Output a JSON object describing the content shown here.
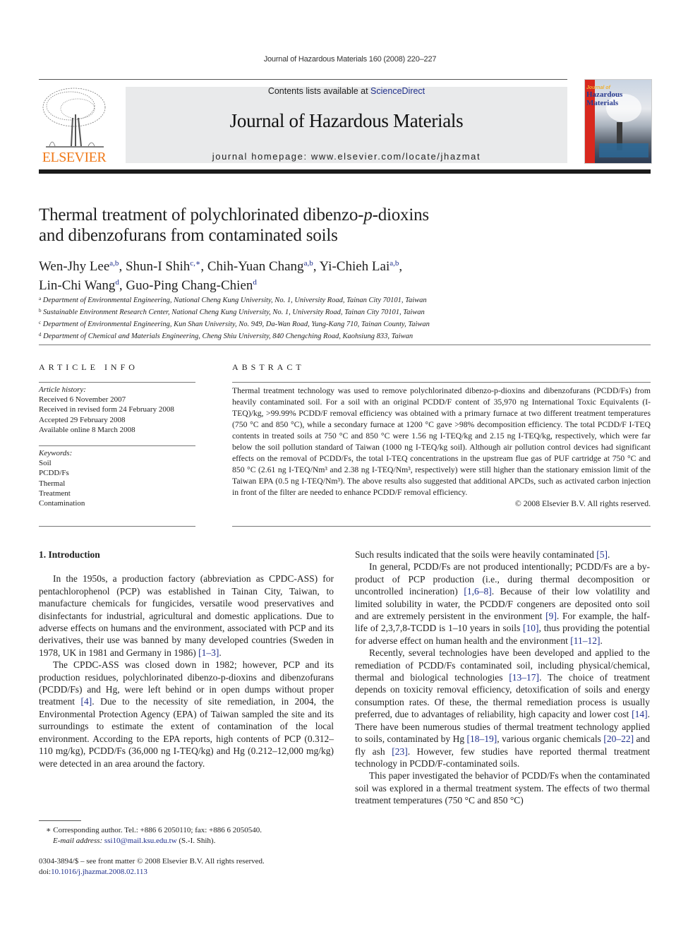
{
  "header": {
    "running_head": "Journal of Hazardous Materials 160 (2008) 220–227",
    "contents_prefix": "Contents lists available at ",
    "contents_link": "ScienceDirect",
    "journal_title": "Journal of Hazardous Materials",
    "homepage_label": "journal homepage: ",
    "homepage_url": "www.elsevier.com/locate/jhazmat",
    "publisher_logo_text": "ELSEVIER",
    "cover_title_1": "Journal of",
    "cover_title_2": "Hazardous",
    "cover_title_3": "Materials",
    "colors": {
      "elsevier_orange": "#f07a1a",
      "link_blue": "#1f2f8c",
      "cover_red": "#d8281e",
      "banner_gray": "#e9eaeb"
    }
  },
  "article": {
    "title_line1_a": "Thermal treatment of polychlorinated dibenzo-",
    "title_line1_p": "p",
    "title_line1_b": "-dioxins",
    "title_line2": "and dibenzofurans from contaminated soils",
    "authors": [
      {
        "name": "Wen-Jhy Lee",
        "aff": "a,b",
        "sep": ", "
      },
      {
        "name": "Shun-I Shih",
        "aff": "c,∗",
        "sep": ", "
      },
      {
        "name": "Chih-Yuan Chang",
        "aff": "a,b",
        "sep": ", "
      },
      {
        "name": "Yi-Chieh Lai",
        "aff": "a,b",
        "sep": ","
      },
      {
        "name": "Lin-Chi Wang",
        "aff": "d",
        "sep": ", "
      },
      {
        "name": "Guo-Ping Chang-Chien",
        "aff": "d",
        "sep": ""
      }
    ],
    "affiliations": [
      {
        "key": "a",
        "text": "Department of Environmental Engineering, National Cheng Kung University, No. 1, University Road, Tainan City 70101, Taiwan"
      },
      {
        "key": "b",
        "text": "Sustainable Environment Research Center, National Cheng Kung University, No. 1, University Road, Tainan City 70101, Taiwan"
      },
      {
        "key": "c",
        "text": "Department of Environmental Engineering, Kun Shan University, No. 949, Da-Wan Road, Yung-Kang 710, Tainan County, Taiwan"
      },
      {
        "key": "d",
        "text": "Department of Chemical and Materials Engineering, Cheng Shiu University, 840 Chengching Road, Kaohsiung 833, Taiwan"
      }
    ]
  },
  "article_info": {
    "heading": "ARTICLE INFO",
    "history_label": "Article history:",
    "history": [
      "Received 6 November 2007",
      "Received in revised form 24 February 2008",
      "Accepted 29 February 2008",
      "Available online 8 March 2008"
    ],
    "keywords_label": "Keywords:",
    "keywords": [
      "Soil",
      "PCDD/Fs",
      "Thermal",
      "Treatment",
      "Contamination"
    ]
  },
  "abstract": {
    "heading": "ABSTRACT",
    "text": "Thermal treatment technology was used to remove polychlorinated dibenzo-p-dioxins and dibenzofurans (PCDD/Fs) from heavily contaminated soil. For a soil with an original PCDD/F content of 35,970 ng International Toxic Equivalents (I-TEQ)/kg, >99.99% PCDD/F removal efficiency was obtained with a primary furnace at two different treatment temperatures (750 °C and 850 °C), while a secondary furnace at 1200 °C gave >98% decomposition efficiency. The total PCDD/F I-TEQ contents in treated soils at 750 °C and 850 °C were 1.56 ng I-TEQ/kg and 2.15 ng I-TEQ/kg, respectively, which were far below the soil pollution standard of Taiwan (1000 ng I-TEQ/kg soil). Although air pollution control devices had significant effects on the removal of PCDD/Fs, the total I-TEQ concentrations in the upstream flue gas of PUF cartridge at 750 °C and 850 °C (2.61 ng I-TEQ/Nm³ and 2.38 ng I-TEQ/Nm³, respectively) were still higher than the stationary emission limit of the Taiwan EPA (0.5 ng I-TEQ/Nm³). The above results also suggested that additional APCDs, such as activated carbon injection in front of the filter are needed to enhance PCDD/F removal efficiency.",
    "copyright": "© 2008 Elsevier B.V. All rights reserved."
  },
  "body": {
    "section_heading": "1. Introduction",
    "left_paragraphs": [
      "In the 1950s, a production factory (abbreviation as CPDC-ASS) for pentachlorophenol (PCP) was established in Tainan City, Taiwan, to manufacture chemicals for fungicides, versatile wood preservatives and disinfectants for industrial, agricultural and domestic applications. Due to adverse effects on humans and the environment, associated with PCP and its derivatives, their use was banned by many developed countries (Sweden in 1978, UK in 1981 and Germany in 1986) [1–3].",
      "The CPDC-ASS was closed down in 1982; however, PCP and its production residues, polychlorinated dibenzo-p-dioxins and dibenzofurans (PCDD/Fs) and Hg, were left behind or in open dumps without proper treatment [4]. Due to the necessity of site remediation, in 2004, the Environmental Protection Agency (EPA) of Taiwan sampled the site and its surroundings to estimate the extent of contamination of the local environment. According to the EPA reports, high contents of PCP (0.312–110 mg/kg), PCDD/Fs (36,000 ng I-TEQ/kg) and Hg (0.212–12,000 mg/kg) were detected in an area around the factory."
    ],
    "right_paragraphs": [
      "Such results indicated that the soils were heavily contaminated [5].",
      "In general, PCDD/Fs are not produced intentionally; PCDD/Fs are a by-product of PCP production (i.e., during thermal decomposition or uncontrolled incineration) [1,6–8]. Because of their low volatility and limited solubility in water, the PCDD/F congeners are deposited onto soil and are extremely persistent in the environment [9]. For example, the half-life of 2,3,7,8-TCDD is 1–10 years in soils [10], thus providing the potential for adverse effect on human health and the environment [11–12].",
      "Recently, several technologies have been developed and applied to the remediation of PCDD/Fs contaminated soil, including physical/chemical, thermal and biological technologies [13–17]. The choice of treatment depends on toxicity removal efficiency, detoxification of soils and energy consumption rates. Of these, the thermal remediation process is usually preferred, due to advantages of reliability, high capacity and lower cost [14]. There have been numerous studies of thermal treatment technology applied to soils, contaminated by Hg [18–19], various organic chemicals [20–22] and fly ash [23]. However, few studies have reported thermal treatment technology in PCDD/F-contaminated soils.",
      "This paper investigated the behavior of PCDD/Fs when the contaminated soil was explored in a thermal treatment system. The effects of two thermal treatment temperatures (750 °C and 850 °C)"
    ]
  },
  "footnotes": {
    "corresponding": "∗  Corresponding author. Tel.: +886 6 2050110; fax: +886 6 2050540.",
    "email_label": "E-mail address: ",
    "email": "ssi10@mail.ksu.edu.tw",
    "email_suffix": " (S.-I. Shih).",
    "front_matter": "0304-3894/$ – see front matter © 2008 Elsevier B.V. All rights reserved.",
    "doi_label": "doi:",
    "doi": "10.1016/j.jhazmat.2008.02.113"
  }
}
